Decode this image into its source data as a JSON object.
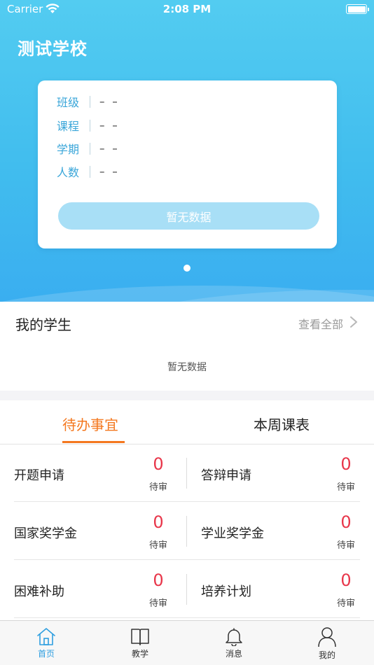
{
  "status_bar": {
    "carrier": "Carrier",
    "time": "2:08 PM"
  },
  "header": {
    "school_name": "测试学校"
  },
  "class_card": {
    "rows": [
      {
        "label": "班级",
        "value": "– –"
      },
      {
        "label": "课程",
        "value": "– –"
      },
      {
        "label": "学期",
        "value": "– –"
      },
      {
        "label": "人数",
        "value": "– –"
      }
    ],
    "button_label": "暂无数据"
  },
  "students": {
    "title": "我的学生",
    "view_all": "查看全部",
    "empty_text": "暂无数据"
  },
  "todo": {
    "tabs": [
      {
        "label": "待办事宜",
        "active": true
      },
      {
        "label": "本周课表",
        "active": false
      }
    ],
    "items": [
      {
        "label": "开题申请",
        "count": "0",
        "status": "待审"
      },
      {
        "label": "答辩申请",
        "count": "0",
        "status": "待审"
      },
      {
        "label": "国家奖学金",
        "count": "0",
        "status": "待审"
      },
      {
        "label": "学业奖学金",
        "count": "0",
        "status": "待审"
      },
      {
        "label": "困难补助",
        "count": "0",
        "status": "待审"
      },
      {
        "label": "培养计划",
        "count": "0",
        "status": "待审"
      }
    ]
  },
  "tab_bar": {
    "items": [
      {
        "label": "首页",
        "icon": "home-icon",
        "active": true
      },
      {
        "label": "教学",
        "icon": "book-icon",
        "active": false
      },
      {
        "label": "消息",
        "icon": "bell-icon",
        "active": false
      },
      {
        "label": "我的",
        "icon": "person-icon",
        "active": false
      }
    ]
  },
  "colors": {
    "accent": "#41bdee",
    "active_tab": "#f4781f",
    "count": "#e8364a",
    "tabbar_active": "#2f9fe0"
  }
}
